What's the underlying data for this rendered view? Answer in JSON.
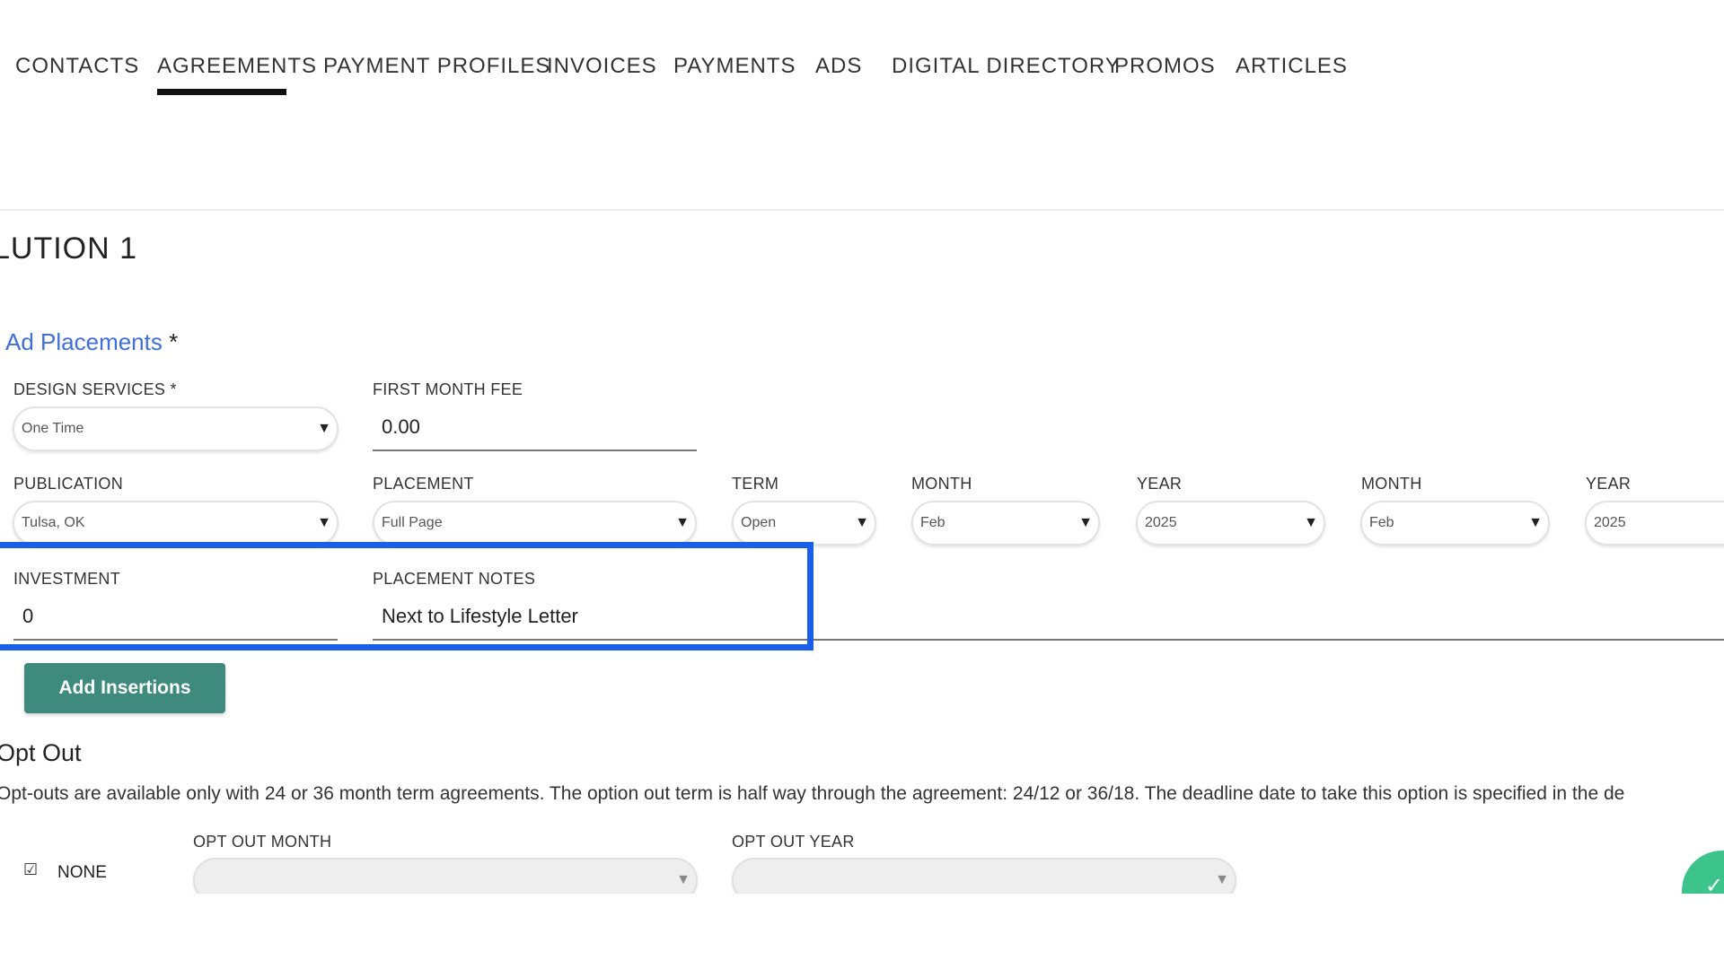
{
  "tabs": {
    "items": [
      {
        "label": "CONTACTS"
      },
      {
        "label": "AGREEMENTS",
        "active": true
      },
      {
        "label": "PAYMENT PROFILES"
      },
      {
        "label": "INVOICES"
      },
      {
        "label": "PAYMENTS"
      },
      {
        "label": "ADS"
      },
      {
        "label": "DIGITAL DIRECTORY"
      },
      {
        "label": "PROMOS"
      },
      {
        "label": "ARTICLES"
      }
    ]
  },
  "page_title": "LUTION 1",
  "section": {
    "title": "Ad Placements",
    "required_mark": "*"
  },
  "form": {
    "design_services": {
      "label": "DESIGN SERVICES *",
      "value": "One Time"
    },
    "first_month_fee": {
      "label": "FIRST MONTH FEE",
      "value": "0.00"
    },
    "publication": {
      "label": "PUBLICATION",
      "value": "Tulsa, OK"
    },
    "placement": {
      "label": "PLACEMENT",
      "value": "Full Page"
    },
    "term": {
      "label": "TERM",
      "value": "Open"
    },
    "start_month": {
      "label": "MONTH",
      "value": "Feb"
    },
    "start_year": {
      "label": "YEAR",
      "value": "2025"
    },
    "end_month": {
      "label": "MONTH",
      "value": "Feb"
    },
    "end_year": {
      "label": "YEAR",
      "value": "2025"
    },
    "investment": {
      "label": "INVESTMENT",
      "value": "0"
    },
    "placement_notes": {
      "label": "PLACEMENT NOTES",
      "value": "Next to Lifestyle Letter"
    }
  },
  "buttons": {
    "add_insertions": "Add Insertions"
  },
  "opt_out": {
    "title": "Opt Out",
    "description": "Opt-outs are available only with 24 or 36 month term agreements. The option out term is half way through the agreement: 24/12 or 36/18. The deadline date to take this option is specified in the de",
    "none_label": "NONE",
    "none_checked": true,
    "month_label": "OPT OUT MONTH",
    "year_label": "OPT OUT YEAR"
  },
  "icons": {
    "select_caret": "caret-down-icon",
    "checkbox": "checkbox-checked-icon",
    "fab": "check-icon"
  },
  "colors": {
    "accent_link": "#3f6fd8",
    "button_primary": "#3e8b7e",
    "highlight_border": "#1a5fe8",
    "fab": "#3cc48c"
  }
}
